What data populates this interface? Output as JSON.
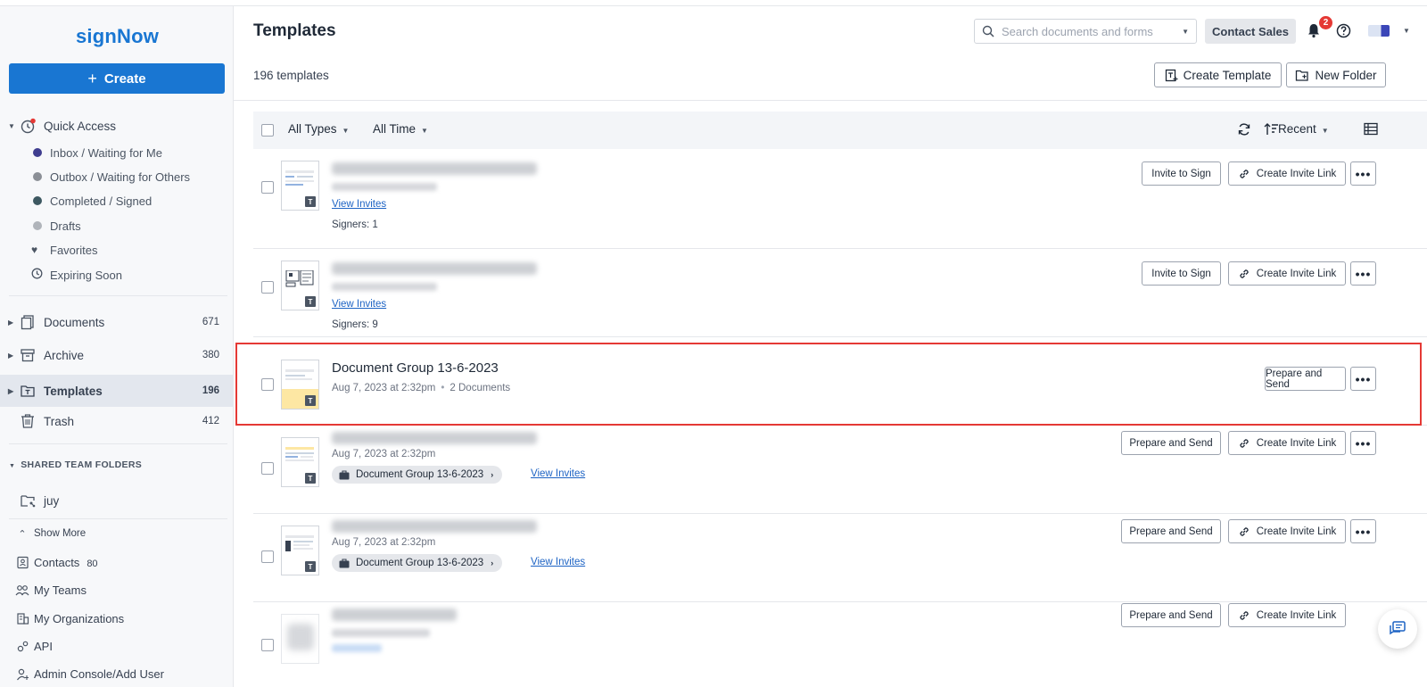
{
  "app": {
    "logo": "signNow",
    "create_label": "Create",
    "create_plus": "+"
  },
  "sidebar": {
    "quick_access": "Quick Access",
    "sub_items": [
      {
        "label": "Inbox / Waiting for Me",
        "color": "#3f3d8f"
      },
      {
        "label": "Outbox / Waiting for Others",
        "color": "#8b8f96"
      },
      {
        "label": "Completed / Signed",
        "color": "#3d5861"
      },
      {
        "label": "Drafts",
        "color": "#b0b4ba"
      },
      {
        "label": "Favorites",
        "icon": "heart-icon"
      },
      {
        "label": "Expiring Soon",
        "icon": "clock-icon"
      }
    ],
    "folders": [
      {
        "label": "Documents",
        "count": "671"
      },
      {
        "label": "Archive",
        "count": "380"
      },
      {
        "label": "Templates",
        "count": "196"
      },
      {
        "label": "Trash",
        "count": "412"
      }
    ],
    "shared_head": "SHARED TEAM FOLDERS",
    "shared_folder": "juy",
    "show_more": "Show More",
    "bottom": [
      {
        "label": "Contacts",
        "count": "80"
      },
      {
        "label": "My Teams"
      },
      {
        "label": "My Organizations"
      },
      {
        "label": "API"
      },
      {
        "label": "Admin Console/Add User"
      }
    ]
  },
  "header": {
    "title": "Templates",
    "search_placeholder": "Search documents and forms",
    "contact_sales": "Contact Sales",
    "notification_count": "2",
    "template_count": "196 templates",
    "create_template": "Create Template",
    "new_folder": "New Folder"
  },
  "toolbar": {
    "all_types": "All Types",
    "all_time": "All Time",
    "sort": "Recent"
  },
  "rows": [
    {
      "view_invites": "View Invites",
      "signers": "Signers: 1",
      "btn1": "Invite to Sign",
      "btn2": "Create Invite Link"
    },
    {
      "view_invites": "View Invites",
      "signers": "Signers: 9",
      "btn1": "Invite to Sign",
      "btn2": "Create Invite Link"
    },
    {
      "title": "Document Group 13-6-2023",
      "date": "Aug 7, 2023 at 2:32pm",
      "docs": "2 Documents",
      "btn1": "Prepare and Send"
    },
    {
      "date": "Aug 7, 2023 at 2:32pm",
      "group": "Document Group 13-6-2023",
      "view_invites": "View Invites",
      "btn1": "Prepare and Send",
      "btn2": "Create Invite Link"
    },
    {
      "date": "Aug 7, 2023 at 2:32pm",
      "group": "Document Group 13-6-2023",
      "view_invites": "View Invites",
      "btn1": "Prepare and Send",
      "btn2": "Create Invite Link"
    },
    {
      "btn1": "Prepare and Send",
      "btn2": "Create Invite Link"
    }
  ],
  "more_label": "•••",
  "template_badge": "T",
  "colors": {
    "brand": "#1976d2",
    "highlight": "#e53935",
    "link": "#1d63c4"
  }
}
